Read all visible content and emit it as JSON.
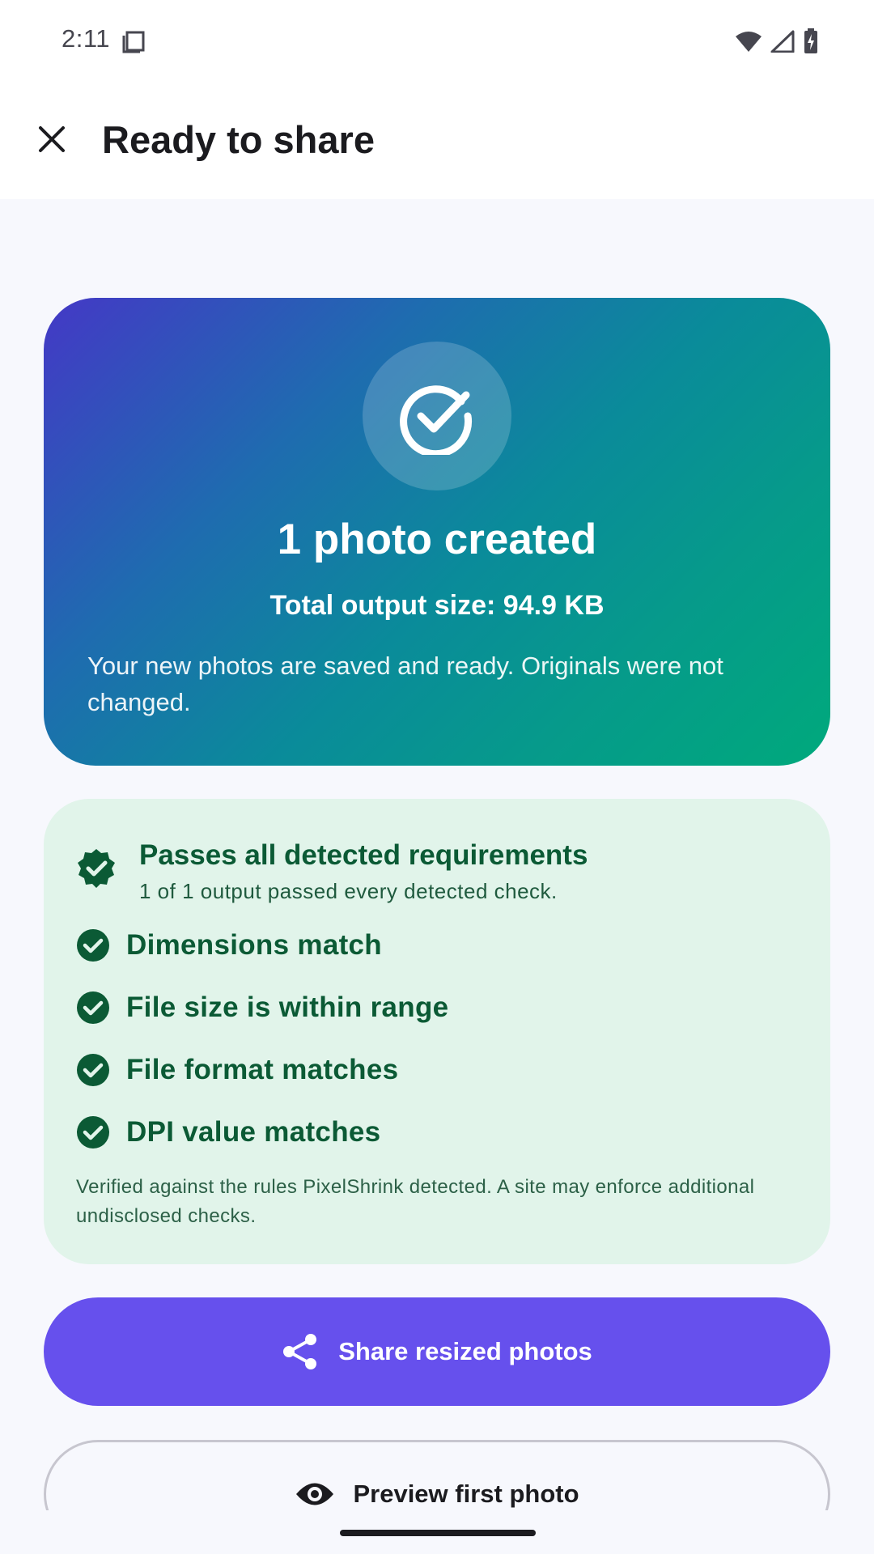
{
  "status_bar": {
    "time": "2:11"
  },
  "app_bar": {
    "title": "Ready to share"
  },
  "hero": {
    "title": "1 photo created",
    "total_size": "Total output size: 94.9 KB",
    "description": "Your new photos are saved and ready. Originals were not changed."
  },
  "checks": {
    "title": "Passes all detected requirements",
    "subtitle": "1 of 1 output passed every detected check.",
    "items": [
      {
        "label": "Dimensions match"
      },
      {
        "label": "File size is within range"
      },
      {
        "label": "File format matches"
      },
      {
        "label": "DPI value matches"
      }
    ],
    "note": "Verified against the rules PixelShrink detected. A site may enforce additional undisclosed checks."
  },
  "actions": {
    "share_label": "Share resized photos",
    "preview_label": "Preview first photo"
  },
  "colors": {
    "primary": "#6650ed",
    "success_bg": "#e1f4ea",
    "success_fg": "#0b5a35",
    "hero_gradient_start": "#4438c6",
    "hero_gradient_end": "#00a97c"
  }
}
